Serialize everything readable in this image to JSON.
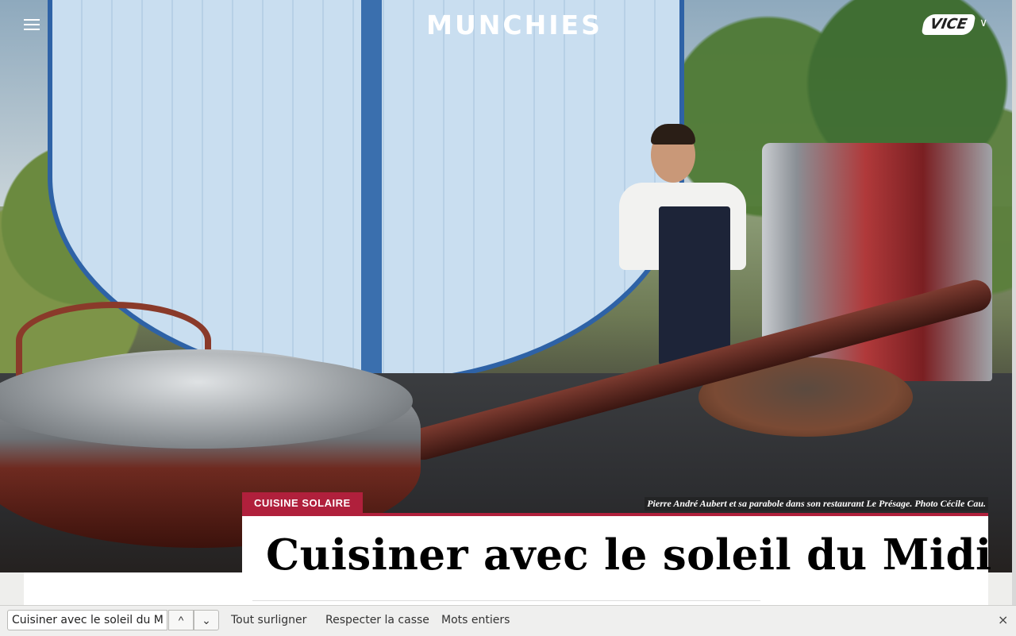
{
  "header": {
    "logo": "MUNCHIES",
    "vice_logo": "VICE",
    "vice_caret": "∨",
    "menu_icon": "hamburger-icon"
  },
  "article": {
    "category": "CUISINE SOLAIRE",
    "caption": "Pierre André Aubert et sa parabole dans son restaurant Le Présage. Photo Cécile Cau.",
    "title": "Cuisiner avec le soleil du Midi",
    "accent_color": "#b0203c"
  },
  "findbar": {
    "search_value": "Cuisiner avec le soleil du Midi",
    "prev_icon": "^",
    "next_icon": "⌄",
    "highlight_all": "Tout surligner",
    "match_case": "Respecter la casse",
    "whole_words": "Mots entiers",
    "close": "×"
  }
}
